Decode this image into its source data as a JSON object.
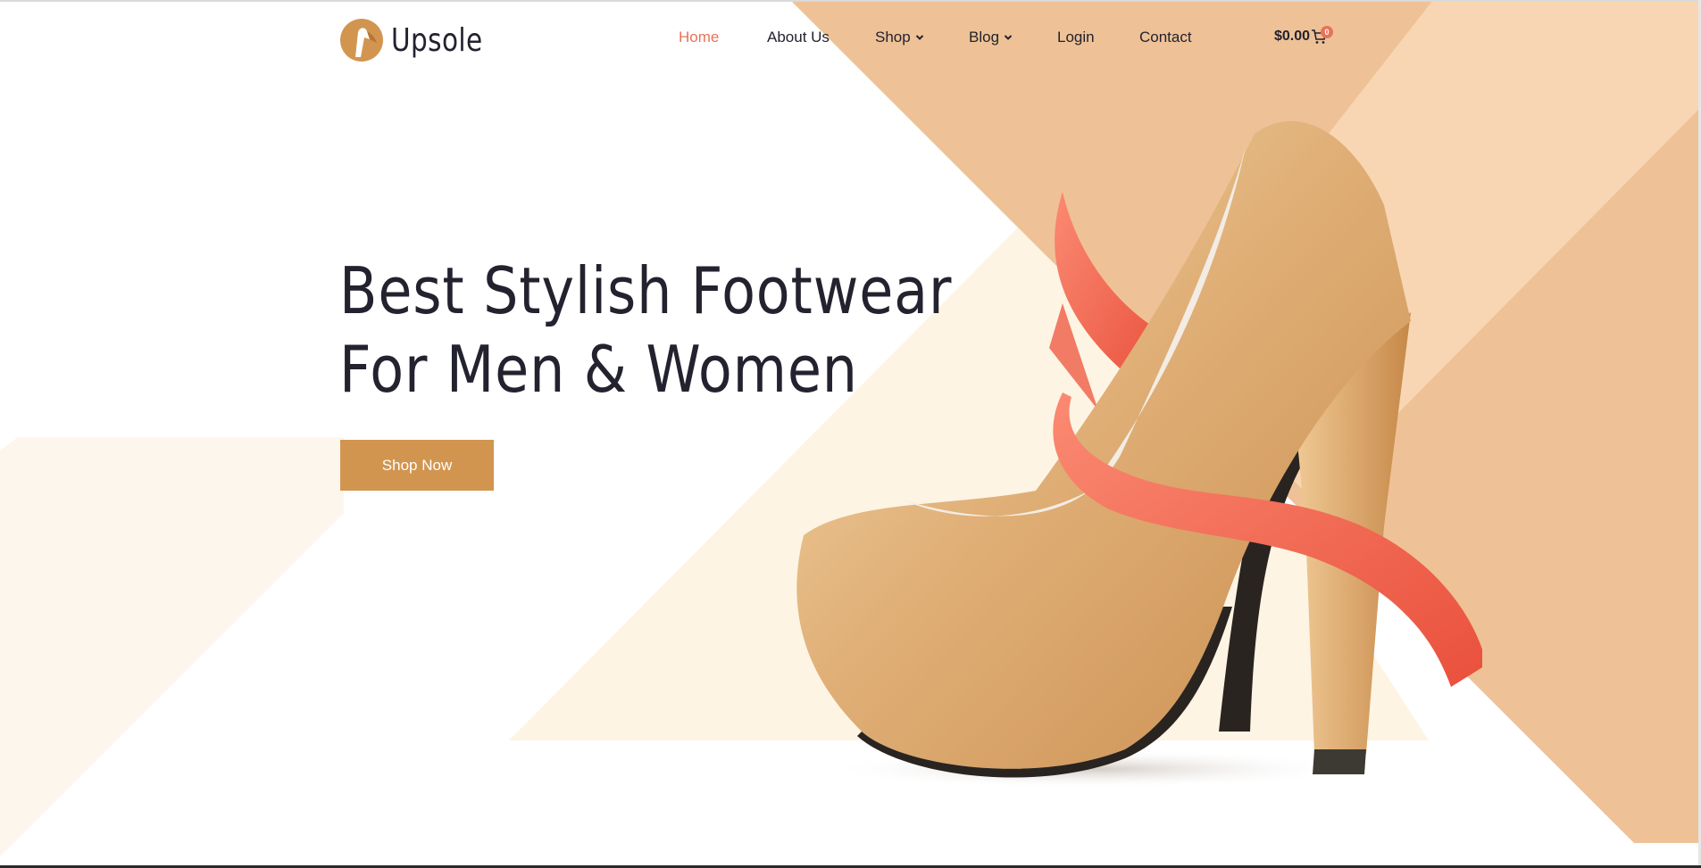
{
  "brand": {
    "name": "Upsole",
    "logo_icon": "high-heel-logo-icon",
    "accent_color": "#d29550"
  },
  "nav": {
    "items": [
      {
        "label": "Home",
        "active": true
      },
      {
        "label": "About Us"
      },
      {
        "label": "Shop",
        "dropdown": true
      },
      {
        "label": "Blog",
        "dropdown": true
      },
      {
        "label": "Login"
      },
      {
        "label": "Contact"
      }
    ],
    "active_color": "#e8735a"
  },
  "cart": {
    "total": "$0.00",
    "count": "0",
    "icon": "cart-icon"
  },
  "hero": {
    "title_line1": "Best Stylish Footwear",
    "title_line2": "For Men & Women",
    "cta_label": "Shop Now",
    "image": "golden-high-heel-shoe-with-red-ribbon"
  },
  "colors": {
    "peach_dark": "#eec296",
    "peach_light": "#f8d6b3",
    "cream": "#fdf4e3",
    "ribbon": "#f06a55",
    "text": "#23222f"
  }
}
